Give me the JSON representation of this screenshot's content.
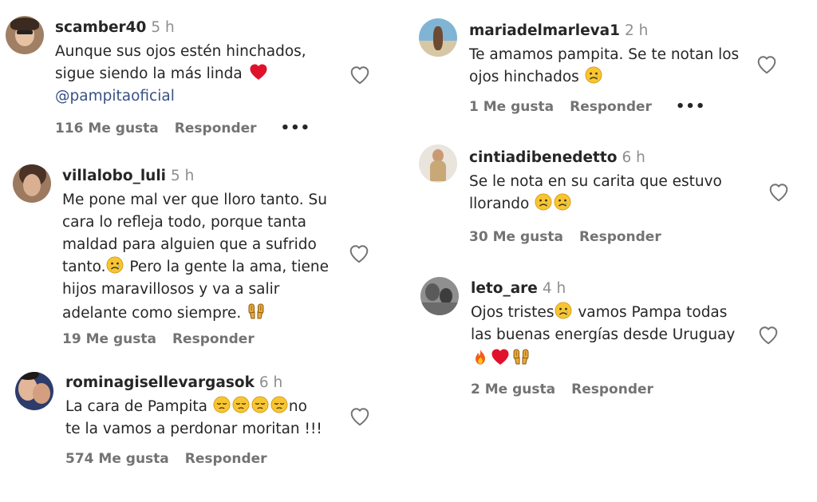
{
  "like_label": "Me gusta",
  "reply_label": "Responder",
  "more_glyph": "•••",
  "comments": [
    {
      "user": "scamber40",
      "time": "5 h",
      "lines": [
        "Aunque sus ojos estén hinchados,",
        "sigue siendo la más linda",
        "@pampitaoficial"
      ],
      "likes": "116"
    },
    {
      "user": "villalobo_luli",
      "time": "5 h",
      "lines": [
        "Me pone mal ver que lloro tanto. Su",
        "cara lo refleja todo, porque tanta",
        "maldad para alguien que a sufrido",
        "tanto.",
        " Pero la gente la ama, tiene",
        "hijos maravillosos y va a salir",
        "adelante como siempre."
      ],
      "likes": "19"
    },
    {
      "user": "rominagisellevargasok",
      "time": "6 h",
      "lines": [
        "La cara de Pampita ",
        "no",
        "te la vamos a perdonar moritan !!!"
      ],
      "likes": "574"
    },
    {
      "user": "mariadelmarleva1",
      "time": "2 h",
      "lines": [
        "Te amamos pampita. Se te notan los",
        "ojos hinchados "
      ],
      "likes": "1"
    },
    {
      "user": "cintiadibenedetto",
      "time": "6 h",
      "lines": [
        "Se le nota en su carita que estuvo",
        "llorando "
      ],
      "likes": "30"
    },
    {
      "user": "leto_are",
      "time": "4 h",
      "lines": [
        "Ojos tristes",
        " vamos Pampa todas",
        "las buenas energías desde Uruguay"
      ],
      "likes": "2"
    }
  ]
}
